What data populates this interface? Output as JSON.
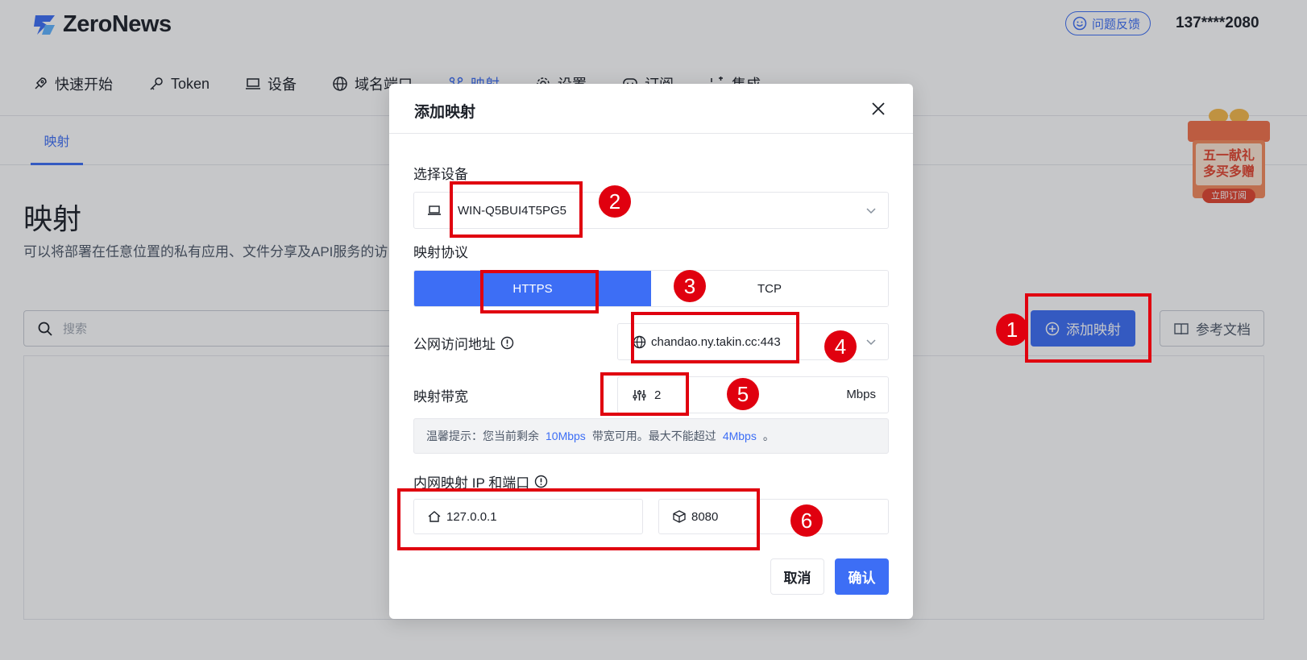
{
  "header": {
    "logo_text": "ZeroNews",
    "feedback_label": "问题反馈",
    "user_phone": "137****2080"
  },
  "nav": {
    "items": [
      {
        "label": "快速开始",
        "icon": "rocket-icon"
      },
      {
        "label": "Token",
        "icon": "key-icon"
      },
      {
        "label": "设备",
        "icon": "laptop-icon"
      },
      {
        "label": "域名端口",
        "icon": "globe-icon"
      },
      {
        "label": "映射",
        "icon": "mapping-icon",
        "active": true
      },
      {
        "label": "设置",
        "icon": "gear-icon"
      },
      {
        "label": "订阅",
        "icon": "chat-icon"
      },
      {
        "label": "集成",
        "icon": "integration-icon"
      }
    ]
  },
  "subtabs": {
    "active": "映射"
  },
  "page": {
    "title": "映射",
    "description": "可以将部署在任意位置的私有应用、文件分享及API服务的访问地址映射到公网，实现公网安全访问。支持 HTTP、HTTPS及TCP 协议类型的应用。",
    "search_placeholder": "搜索",
    "add_button": "添加映射",
    "docs_button": "参考文档"
  },
  "promo": {
    "line1": "五一献礼",
    "line2": "多买多赠",
    "cta": "立即订阅"
  },
  "modal": {
    "title": "添加映射",
    "device_label": "选择设备",
    "device_value": "WIN-Q5BUI4T5PG5",
    "protocol_label": "映射协议",
    "protocols": [
      "HTTPS",
      "TCP"
    ],
    "protocol_selected": "HTTPS",
    "url_label": "公网访问地址",
    "url_value": "chandao.ny.takin.cc:443",
    "bandwidth_label": "映射带宽",
    "bandwidth_value": "2",
    "bandwidth_unit": "Mbps",
    "tip_prefix": "温馨提示：您当前剩余",
    "tip_remaining": "10Mbps",
    "tip_middle": "带宽可用。最大不能超过",
    "tip_max": "4Mbps",
    "tip_suffix": "。",
    "internal_label": "内网映射 IP 和端口",
    "ip_value": "127.0.0.1",
    "port_value": "8080",
    "cancel_label": "取消",
    "confirm_label": "确认"
  },
  "annotations": {
    "markers": [
      "1",
      "2",
      "3",
      "4",
      "5",
      "6"
    ],
    "color": "#e0000f"
  },
  "colors": {
    "accent": "#3d6ef5",
    "annotation": "#e0000f"
  }
}
